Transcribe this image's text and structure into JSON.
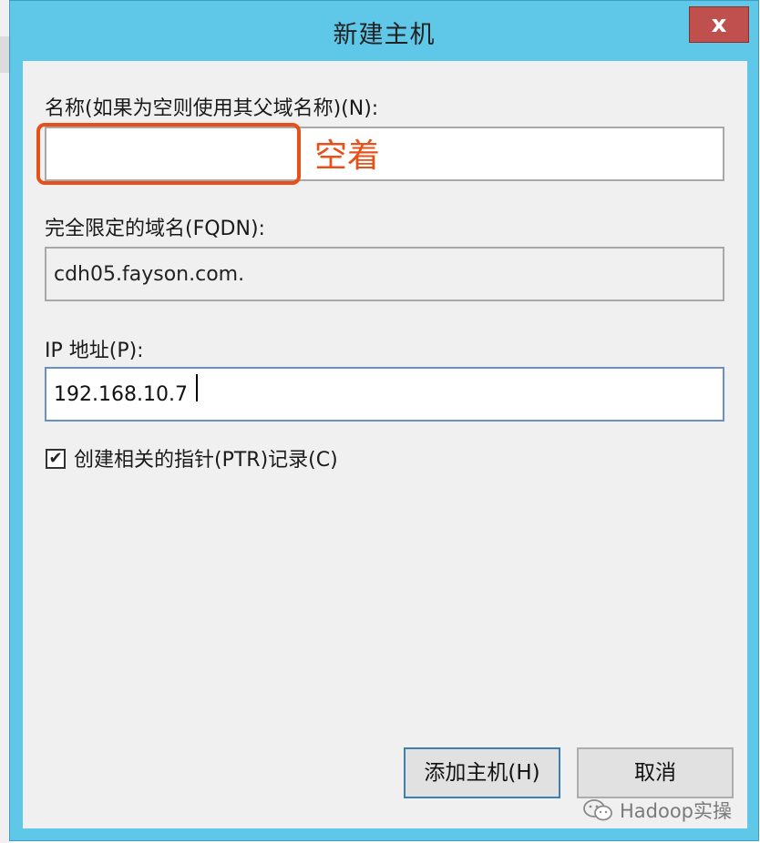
{
  "dialog": {
    "title": "新建主机",
    "close_glyph": "x"
  },
  "form": {
    "name_label": "名称(如果为空则使用其父域名称)(N):",
    "name_value": "",
    "name_annotation": "空着",
    "fqdn_label": "完全限定的域名(FQDN):",
    "fqdn_value": "cdh05.fayson.com.",
    "ip_label": "IP 地址(P):",
    "ip_value": "192.168.10.7",
    "ptr_checkbox_label": "创建相关的指针(PTR)记录(C)",
    "ptr_checked": true,
    "check_glyph": "✔"
  },
  "buttons": {
    "add_host": "添加主机(H)",
    "cancel": "取消"
  },
  "watermark": {
    "text": "Hadoop实操",
    "icon": "wechat-icon"
  },
  "colors": {
    "titlebar": "#5fc8e8",
    "close_button": "#c0504d",
    "annotation": "#e8501a"
  }
}
